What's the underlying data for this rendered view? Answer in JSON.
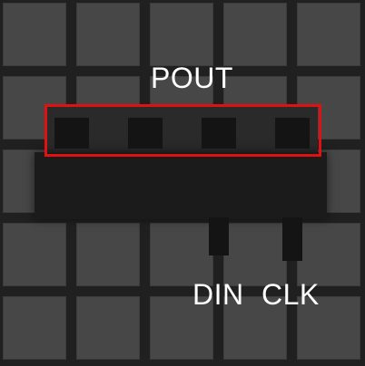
{
  "labels": {
    "pout": "POUT",
    "din": "DIN",
    "clk": "CLK"
  },
  "colors": {
    "background": "#202020",
    "tile": "#474747",
    "chip": "#1b1b1b",
    "highlight": "#e11111",
    "text": "#ffffff"
  }
}
